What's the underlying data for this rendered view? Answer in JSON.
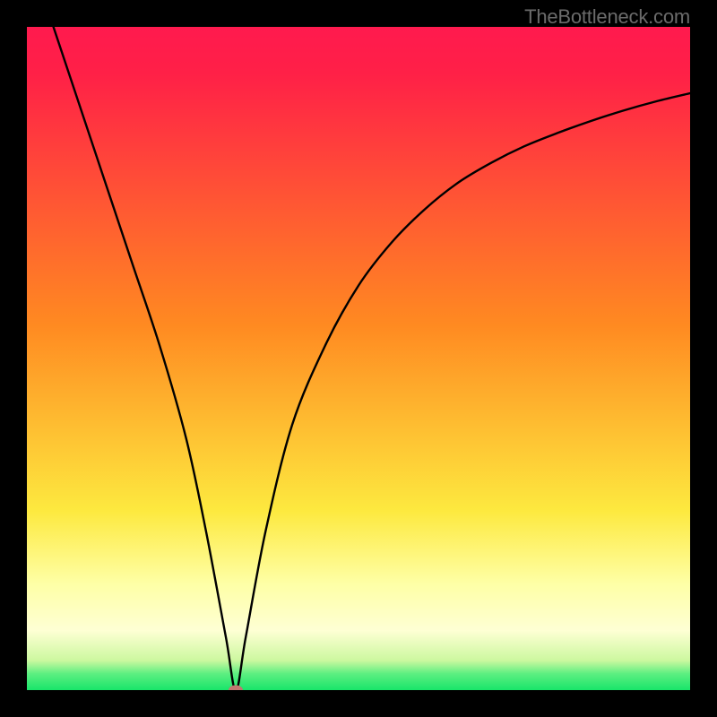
{
  "watermark": "TheBottleneck.com",
  "colors": {
    "black": "#000000",
    "red_top": "#ff1a4e",
    "orange": "#ff8a21",
    "yellow": "#fef241",
    "pale_yellow": "#feffa6",
    "green": "#18e56a",
    "curve": "#000000",
    "marker": "#c1766f"
  },
  "chart_data": {
    "type": "line",
    "title": "",
    "xlabel": "",
    "ylabel": "",
    "xlim": [
      0,
      100
    ],
    "ylim": [
      0,
      100
    ],
    "grid": false,
    "legend": false,
    "series": [
      {
        "name": "curve",
        "x": [
          4,
          8,
          12,
          16,
          20,
          24,
          27,
          30,
          31.5,
          33,
          36,
          40,
          45,
          50,
          55,
          60,
          65,
          70,
          75,
          80,
          85,
          90,
          95,
          100
        ],
        "y": [
          100,
          88,
          76,
          64,
          52,
          38,
          24,
          8,
          0,
          8,
          24,
          40,
          52,
          61,
          67.5,
          72.5,
          76.5,
          79.5,
          82,
          84,
          85.8,
          87.4,
          88.8,
          90
        ]
      }
    ],
    "marker": {
      "x": 31.5,
      "y": 0
    },
    "background_gradient_stops": [
      {
        "pos": 0.0,
        "color": "#ff1a4e"
      },
      {
        "pos": 0.07,
        "color": "#ff2047"
      },
      {
        "pos": 0.45,
        "color": "#ff8a21"
      },
      {
        "pos": 0.73,
        "color": "#fde93f"
      },
      {
        "pos": 0.84,
        "color": "#feffa6"
      },
      {
        "pos": 0.91,
        "color": "#feffd4"
      },
      {
        "pos": 0.955,
        "color": "#cdf8a0"
      },
      {
        "pos": 0.975,
        "color": "#5eef81"
      },
      {
        "pos": 1.0,
        "color": "#18e56a"
      }
    ]
  }
}
